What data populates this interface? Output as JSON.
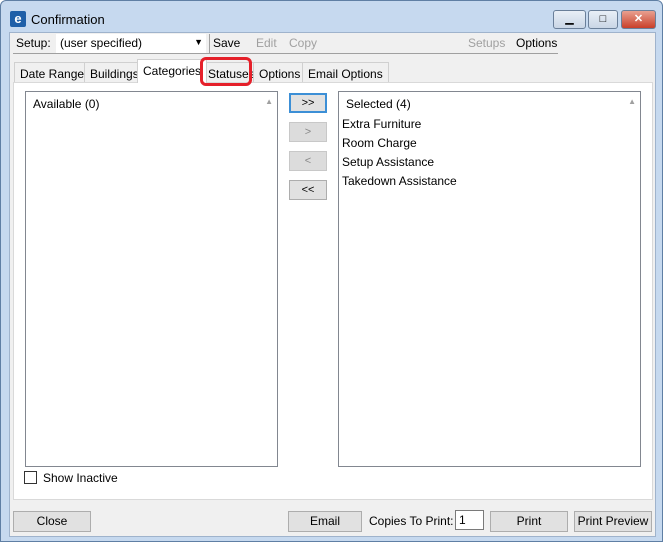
{
  "window": {
    "title": "Confirmation",
    "icon": "app-e-logo-icon",
    "minimize": "▁",
    "maximize": "□",
    "close": "✕"
  },
  "toolbar": {
    "setup_label": "Setup:",
    "setup_value": "(user specified)",
    "save": "Save",
    "edit": "Edit",
    "copy": "Copy",
    "setups": "Setups",
    "options": "Options"
  },
  "tabs": [
    {
      "label": "Date Range"
    },
    {
      "label": "Buildings"
    },
    {
      "label": "Categories",
      "active": true
    },
    {
      "label": "Statuses",
      "highlighted": true
    },
    {
      "label": "Options"
    },
    {
      "label": "Email Options"
    }
  ],
  "highlight_color": "#e5202a",
  "available": {
    "header": "Available (0)",
    "items": []
  },
  "selected": {
    "header": "Selected (4)",
    "items": [
      "Extra Furniture",
      "Room Charge",
      "Setup Assistance",
      "Takedown Assistance"
    ]
  },
  "move": {
    "all_right": ">>",
    "right": ">",
    "left": "<",
    "all_left": "<<"
  },
  "show_inactive": {
    "label": "Show Inactive",
    "checked": false
  },
  "footer": {
    "close": "Close",
    "email": "Email",
    "copies_label": "Copies To Print:",
    "copies_value": "1",
    "print": "Print",
    "print_preview": "Print Preview"
  }
}
